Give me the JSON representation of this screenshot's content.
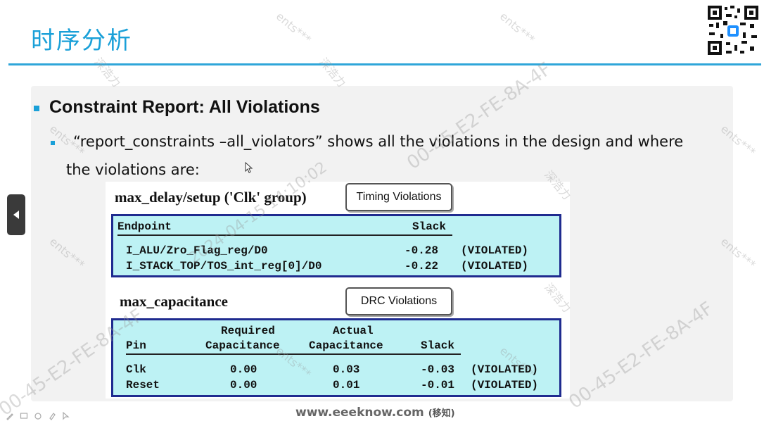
{
  "slide": {
    "title": "时序分析",
    "heading": "Constraint Report: All Violations",
    "desc_line1": "“report_constraints –all_violators”   shows all the violations in the design and where",
    "desc_line2": "the violations are:"
  },
  "figure": {
    "timing": {
      "label": "max_delay/setup ('Clk' group)",
      "callout": "Timing Violations",
      "headers": {
        "endpoint": "Endpoint",
        "slack": "Slack"
      },
      "rows": [
        {
          "endpoint": "I_ALU/Zro_Flag_reg/D0",
          "slack": "-0.28",
          "status": "(VIOLATED)"
        },
        {
          "endpoint": "I_STACK_TOP/TOS_int_reg[0]/D0",
          "slack": "-0.22",
          "status": "(VIOLATED)"
        }
      ]
    },
    "drc": {
      "label": "max_capacitance",
      "callout": "DRC Violations",
      "headers": {
        "pin": "Pin",
        "required_top": "Required",
        "required_bottom": "Capacitance",
        "actual_top": "Actual",
        "actual_bottom": "Capacitance",
        "slack": "Slack"
      },
      "rows": [
        {
          "pin": "Clk",
          "required": "0.00",
          "actual": "0.03",
          "slack": "-0.03",
          "status": "(VIOLATED)"
        },
        {
          "pin": "Reset",
          "required": "0.00",
          "actual": "0.01",
          "slack": "-0.01",
          "status": "(VIOLATED)"
        }
      ]
    }
  },
  "footer": {
    "url": "www.eeeknow.com",
    "cn": "(移知)"
  },
  "watermarks": {
    "ents": "ents***",
    "cn": "深浩力",
    "code": "00-45-E2-FE-8A-4F",
    "date": "2024-04-15 14:10:02"
  },
  "icons": [
    "qr-code-icon",
    "prev-slide-icon",
    "pen-icon",
    "screen-icon",
    "eraser-icon",
    "pointer-icon"
  ],
  "colors": {
    "accent": "#1aa0d8",
    "box_fill": "#bdf2f4",
    "box_border": "#1f2b8f"
  }
}
